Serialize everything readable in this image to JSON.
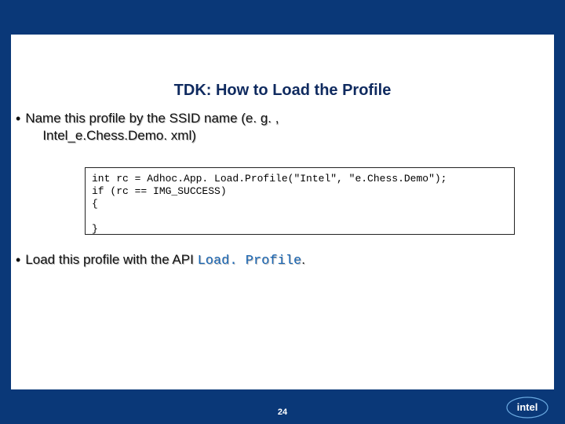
{
  "title": "TDK: How to Load the Profile",
  "bullets": {
    "first": {
      "line1": "Name this profile by the SSID name (e. g. ,",
      "line2": "Intel_e.Chess.Demo. xml)"
    },
    "second": {
      "prefix": "Load this profile with the API ",
      "api": "Load. Profile",
      "suffix": "."
    }
  },
  "code": "int rc = Adhoc.App. Load.Profile(\"Intel\", \"e.Chess.Demo\");\nif (rc == IMG_SUCCESS)\n{\n\n}",
  "page_number": "24",
  "logo_text": "intel"
}
